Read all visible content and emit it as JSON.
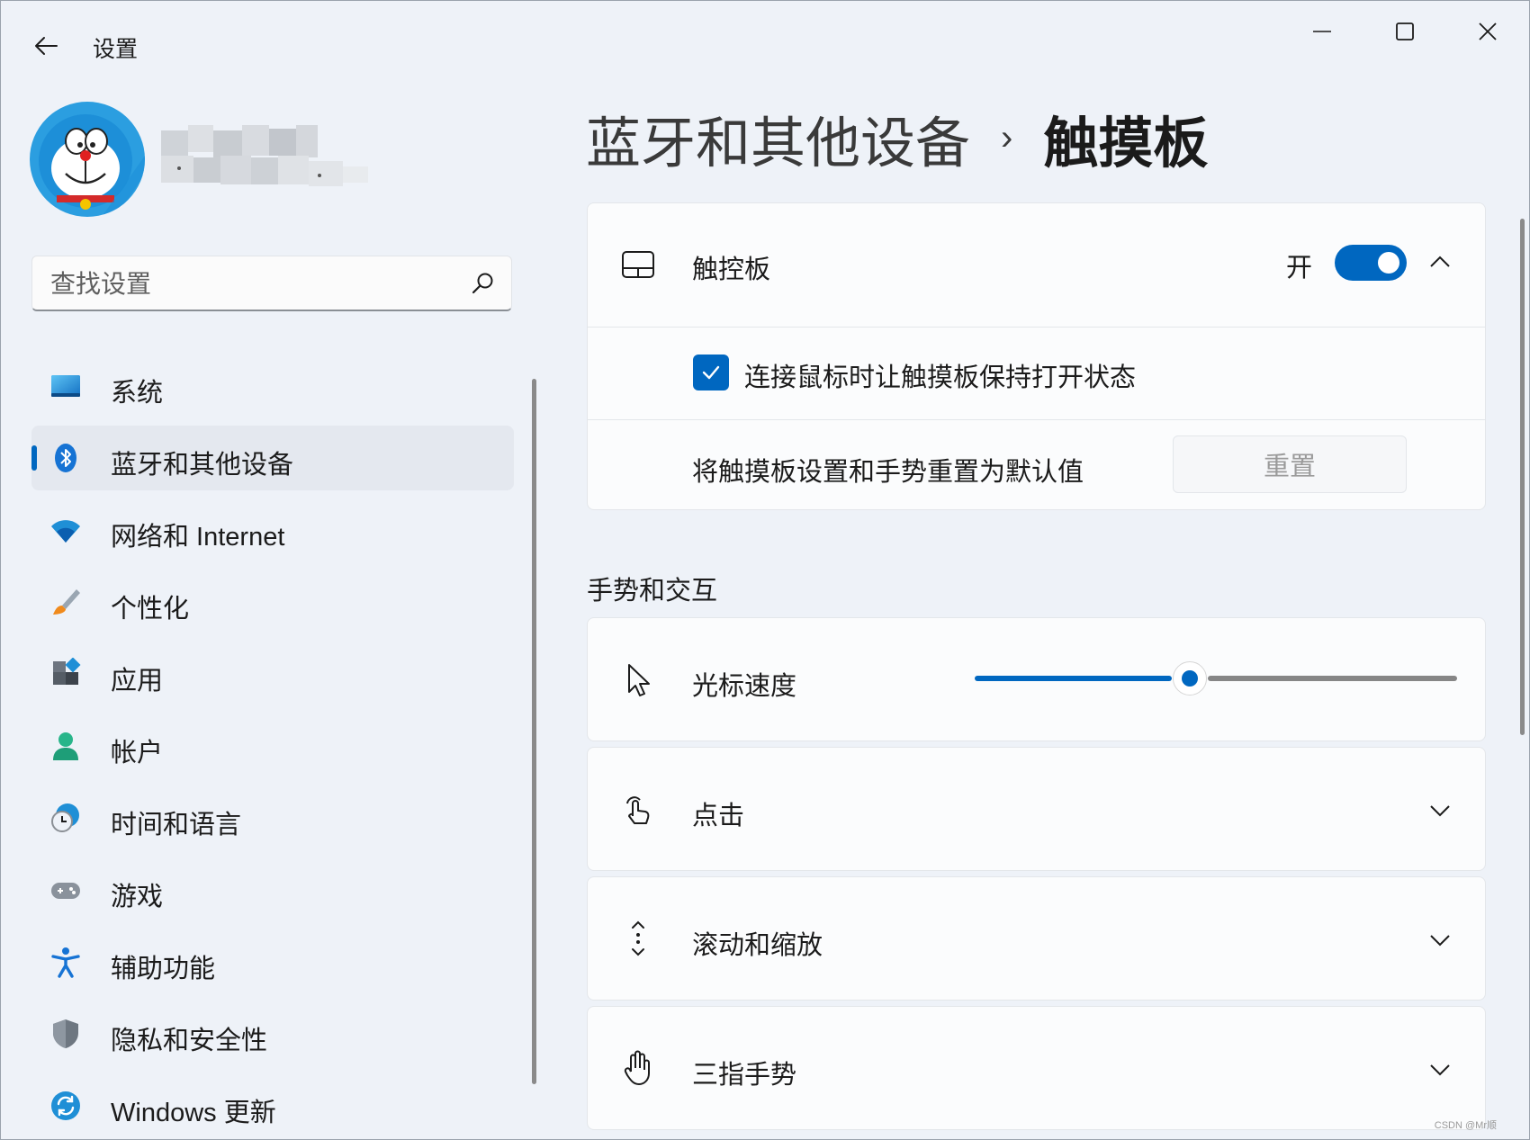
{
  "window": {
    "title": "设置",
    "controls": {
      "minimize": "minimize-icon",
      "maximize": "maximize-icon",
      "close": "close-icon"
    }
  },
  "search": {
    "placeholder": "查找设置",
    "value": ""
  },
  "sidebar": {
    "items": [
      {
        "label": "系统",
        "icon": "system-display-icon"
      },
      {
        "label": "蓝牙和其他设备",
        "icon": "bluetooth-icon",
        "active": true
      },
      {
        "label": "网络和 Internet",
        "icon": "wifi-icon"
      },
      {
        "label": "个性化",
        "icon": "brush-icon"
      },
      {
        "label": "应用",
        "icon": "apps-icon"
      },
      {
        "label": "帐户",
        "icon": "account-icon"
      },
      {
        "label": "时间和语言",
        "icon": "time-language-icon"
      },
      {
        "label": "游戏",
        "icon": "gamepad-icon"
      },
      {
        "label": "辅助功能",
        "icon": "accessibility-icon"
      },
      {
        "label": "隐私和安全性",
        "icon": "shield-icon"
      },
      {
        "label": "Windows 更新",
        "icon": "update-icon"
      }
    ]
  },
  "breadcrumb": {
    "parent": "蓝牙和其他设备",
    "separator": "›",
    "current": "触摸板"
  },
  "touchpad_card": {
    "label": "触控板",
    "toggle_state": "开",
    "toggle_on": true,
    "keep_on_label": "连接鼠标时让触摸板保持打开状态",
    "keep_on_checked": true,
    "reset_label": "将触摸板设置和手势重置为默认值",
    "reset_button": "重置"
  },
  "gestures": {
    "section_title": "手势和交互",
    "cursor_speed": {
      "label": "光标速度",
      "value_fraction": 0.445
    },
    "rows": [
      {
        "label": "点击",
        "icon": "tap-hand-icon"
      },
      {
        "label": "滚动和缩放",
        "icon": "scroll-icon"
      },
      {
        "label": "三指手势",
        "icon": "three-finger-hand-icon"
      }
    ]
  },
  "colors": {
    "accent": "#0067c0",
    "background": "#eef2f8",
    "card": "#fbfcfd"
  },
  "watermark": "CSDN @Mr顺"
}
